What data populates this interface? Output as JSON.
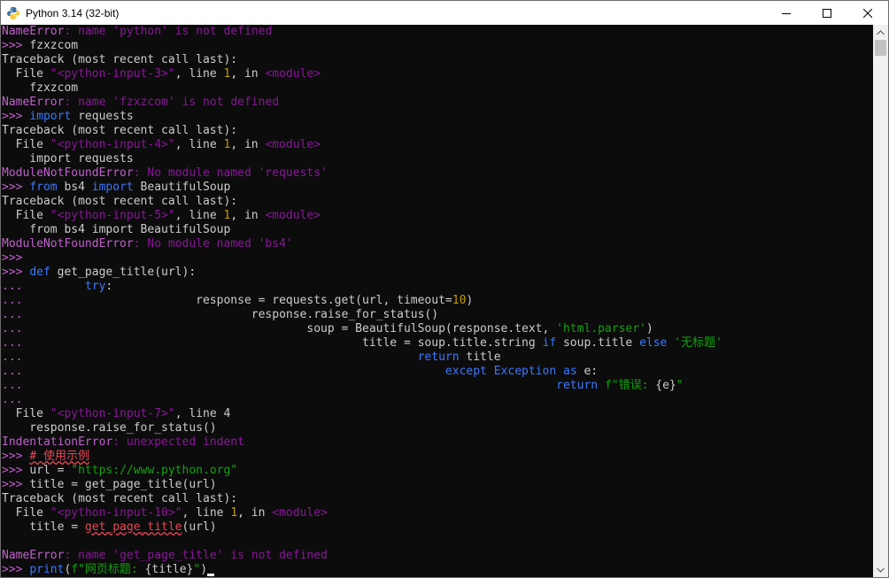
{
  "window": {
    "title": "Python 3.14 (32-bit)",
    "minimize_icon": "minimize-icon",
    "maximize_icon": "maximize-icon",
    "close_icon": "close-icon"
  },
  "colors": {
    "background": "#0c0c0c",
    "prompt": "#c061cb",
    "keyword": "#3b78ff",
    "string": "#13a10e",
    "error": "#881798",
    "number": "#c19c00"
  },
  "lines": [
    [
      [
        "NameError",
        "err"
      ],
      [
        ": name ",
        "errmsg"
      ],
      [
        "'python'",
        "errmsg"
      ],
      [
        " is not defined",
        "errmsg"
      ]
    ],
    [
      [
        ">>> ",
        "prompt"
      ],
      [
        "fzxzcom",
        "def"
      ]
    ],
    [
      [
        "Traceback (most recent call last):",
        "tb"
      ]
    ],
    [
      [
        "  File ",
        "tb"
      ],
      [
        "\"<python-input-3>\"",
        "file"
      ],
      [
        ", line ",
        "tb"
      ],
      [
        "1",
        "num"
      ],
      [
        ", in ",
        "tb"
      ],
      [
        "<module>",
        "file"
      ]
    ],
    [
      [
        "    fzxzcom",
        "tb"
      ]
    ],
    [
      [
        "NameError",
        "err"
      ],
      [
        ": name ",
        "errmsg"
      ],
      [
        "'fzxzcom'",
        "errmsg"
      ],
      [
        " is not defined",
        "errmsg"
      ]
    ],
    [
      [
        ">>> ",
        "prompt"
      ],
      [
        "import",
        "kw"
      ],
      [
        " requests",
        "def"
      ]
    ],
    [
      [
        "Traceback (most recent call last):",
        "tb"
      ]
    ],
    [
      [
        "  File ",
        "tb"
      ],
      [
        "\"<python-input-4>\"",
        "file"
      ],
      [
        ", line ",
        "tb"
      ],
      [
        "1",
        "num"
      ],
      [
        ", in ",
        "tb"
      ],
      [
        "<module>",
        "file"
      ]
    ],
    [
      [
        "    import requests",
        "tb"
      ]
    ],
    [
      [
        "ModuleNotFoundError",
        "err"
      ],
      [
        ": No module named ",
        "errmsg"
      ],
      [
        "'requests'",
        "errmsg"
      ]
    ],
    [
      [
        ">>> ",
        "prompt"
      ],
      [
        "from",
        "kw"
      ],
      [
        " bs4 ",
        "def"
      ],
      [
        "import",
        "kw"
      ],
      [
        " BeautifulSoup",
        "def"
      ]
    ],
    [
      [
        "Traceback (most recent call last):",
        "tb"
      ]
    ],
    [
      [
        "  File ",
        "tb"
      ],
      [
        "\"<python-input-5>\"",
        "file"
      ],
      [
        ", line ",
        "tb"
      ],
      [
        "1",
        "num"
      ],
      [
        ", in ",
        "tb"
      ],
      [
        "<module>",
        "file"
      ]
    ],
    [
      [
        "    from bs4 import BeautifulSoup",
        "tb"
      ]
    ],
    [
      [
        "ModuleNotFoundError",
        "err"
      ],
      [
        ": No module named ",
        "errmsg"
      ],
      [
        "'bs4'",
        "errmsg"
      ]
    ],
    [
      [
        ">>> ",
        "prompt"
      ]
    ],
    [
      [
        ">>> ",
        "prompt"
      ],
      [
        "def",
        "kw"
      ],
      [
        " get_page_title(url):",
        "def"
      ]
    ],
    [
      [
        "... ",
        "prompt"
      ],
      [
        "        ",
        "def"
      ],
      [
        "try",
        "kw"
      ],
      [
        ":",
        "def"
      ]
    ],
    [
      [
        "... ",
        "prompt"
      ],
      [
        "                        response = requests.get(url, timeout=",
        "def"
      ],
      [
        "10",
        "num"
      ],
      [
        ")",
        "def"
      ]
    ],
    [
      [
        "... ",
        "prompt"
      ],
      [
        "                                response.raise_for_status()",
        "def"
      ]
    ],
    [
      [
        "... ",
        "prompt"
      ],
      [
        "                                        soup = BeautifulSoup(response.text, ",
        "def"
      ],
      [
        "'html.parser'",
        "str"
      ],
      [
        ")",
        "def"
      ]
    ],
    [
      [
        "... ",
        "prompt"
      ],
      [
        "                                                title = soup.title.string ",
        "def"
      ],
      [
        "if",
        "kw"
      ],
      [
        " soup.title ",
        "def"
      ],
      [
        "else",
        "kw"
      ],
      [
        " ",
        "def"
      ],
      [
        "'无标题'",
        "str"
      ]
    ],
    [
      [
        "... ",
        "prompt"
      ],
      [
        "                                                        ",
        "def"
      ],
      [
        "return",
        "kw"
      ],
      [
        " title",
        "def"
      ]
    ],
    [
      [
        "... ",
        "prompt"
      ],
      [
        "                                                            ",
        "def"
      ],
      [
        "except",
        "kw"
      ],
      [
        " ",
        "def"
      ],
      [
        "Exception",
        "kw"
      ],
      [
        " ",
        "def"
      ],
      [
        "as",
        "kw"
      ],
      [
        " e:",
        "def"
      ]
    ],
    [
      [
        "... ",
        "prompt"
      ],
      [
        "                                                                            ",
        "def"
      ],
      [
        "return",
        "kw"
      ],
      [
        " ",
        "def"
      ],
      [
        "f\"错误: ",
        "str"
      ],
      [
        "{e}",
        "def"
      ],
      [
        "\"",
        "str"
      ]
    ],
    [
      [
        "... ",
        "prompt"
      ]
    ],
    [
      [
        "  File ",
        "tb"
      ],
      [
        "\"<python-input-7>\"",
        "file"
      ],
      [
        ", line ",
        "tb"
      ],
      [
        "4",
        "tb"
      ]
    ],
    [
      [
        "    response.raise_for_status()",
        "tb"
      ]
    ],
    [
      [
        "IndentationError",
        "err"
      ],
      [
        ": unexpected indent",
        "errmsg"
      ]
    ],
    [
      [
        ">>> ",
        "prompt"
      ],
      [
        "# 使用示例",
        "ul2"
      ]
    ],
    [
      [
        ">>> ",
        "prompt"
      ],
      [
        "url = ",
        "def"
      ],
      [
        "\"https://www.python.org\"",
        "str"
      ]
    ],
    [
      [
        ">>> ",
        "prompt"
      ],
      [
        "title = get_page_title(url)",
        "def"
      ]
    ],
    [
      [
        "Traceback (most recent call last):",
        "tb"
      ]
    ],
    [
      [
        "  File ",
        "tb"
      ],
      [
        "\"<python-input-10>\"",
        "file"
      ],
      [
        ", line ",
        "tb"
      ],
      [
        "1",
        "num"
      ],
      [
        ", in ",
        "tb"
      ],
      [
        "<module>",
        "file"
      ]
    ],
    [
      [
        "    title = ",
        "tb"
      ],
      [
        "get_page_title",
        "ul"
      ],
      [
        "(url)",
        "tb"
      ]
    ],
    [
      [
        "",
        "def"
      ]
    ],
    [
      [
        "NameError",
        "err"
      ],
      [
        ": name ",
        "errmsg"
      ],
      [
        "'get_page_title'",
        "errmsg"
      ],
      [
        " is not defined",
        "errmsg"
      ]
    ],
    [
      [
        ">>> ",
        "prompt"
      ],
      [
        "print",
        "kw"
      ],
      [
        "(",
        "def"
      ],
      [
        "f\"网页标题: ",
        "str"
      ],
      [
        "{title}",
        "def"
      ],
      [
        "\"",
        "str"
      ],
      [
        ")",
        "def"
      ],
      [
        "",
        "cursor"
      ]
    ]
  ]
}
